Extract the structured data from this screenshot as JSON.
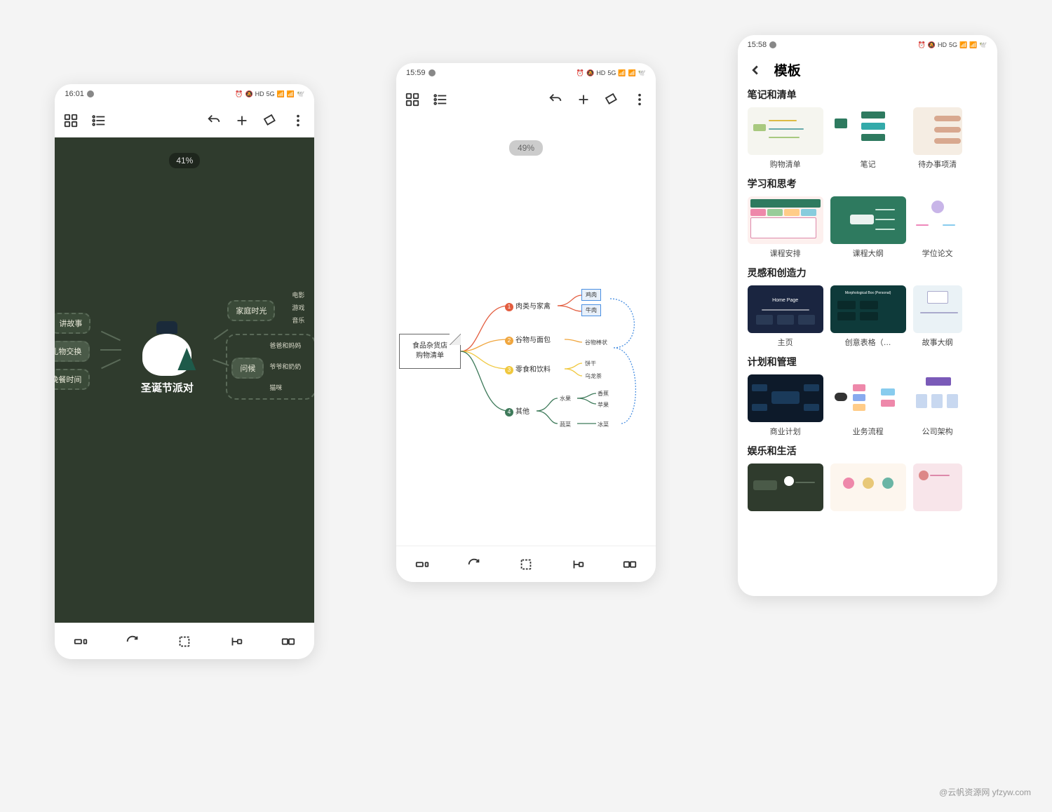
{
  "watermark": "@云帆资源网 yfzyw.com",
  "phone1": {
    "time": "16:01",
    "zoom": "41%",
    "mindmap": {
      "center": "圣诞节派对",
      "left_nodes": [
        "讲故事",
        "礼物交换",
        "晚餐时间"
      ],
      "right_top": {
        "label": "家庭时光",
        "leaves": [
          "电影",
          "游戏",
          "音乐"
        ]
      },
      "right_bottom": {
        "label": "问候",
        "leaves": [
          "爸爸和妈妈",
          "爷爷和奶奶",
          "猫咪"
        ]
      }
    }
  },
  "phone2": {
    "time": "15:59",
    "zoom": "49%",
    "mindmap": {
      "root_l1": "食品杂货店",
      "root_l2": "购物清单",
      "branches": [
        {
          "num": "1",
          "color": "#e35d3f",
          "label": "肉类与家禽",
          "subleaves": [
            "鸡肉",
            "牛肉"
          ]
        },
        {
          "num": "2",
          "color": "#f0a63e",
          "label": "谷物与面包",
          "subleaves": [
            "谷物棒状"
          ]
        },
        {
          "num": "3",
          "color": "#f0c83e",
          "label": "零食和饮料",
          "subleaves": [
            "饼干",
            "乌龙茶"
          ]
        },
        {
          "num": "4",
          "color": "#3e7a5a",
          "label": "其他",
          "children": [
            {
              "label": "水果",
              "subs": [
                "香蕉",
                "苹果"
              ]
            },
            {
              "label": "蔬菜",
              "subs": [
                "冰菜"
              ]
            }
          ]
        }
      ]
    }
  },
  "phone3": {
    "time": "15:58",
    "title": "模板",
    "sections": [
      {
        "title": "笔记和清单",
        "items": [
          {
            "caption": "购物清单",
            "bg": "#f5f5ef"
          },
          {
            "caption": "笔记",
            "bg": "#ffffff"
          },
          {
            "caption": "待办事项清",
            "bg": "#f5ede3"
          }
        ]
      },
      {
        "title": "学习和思考",
        "items": [
          {
            "caption": "课程安排",
            "bg": "#fdf0ee"
          },
          {
            "caption": "课程大纲",
            "bg": "#2e7a5f"
          },
          {
            "caption": "学位论文",
            "bg": "#ffffff"
          }
        ]
      },
      {
        "title": "灵感和创造力",
        "items": [
          {
            "caption": "主页",
            "bg": "#1a2540"
          },
          {
            "caption": "创意表格（…",
            "bg": "#0e3a3a"
          },
          {
            "caption": "故事大纲",
            "bg": "#eaf2f6"
          }
        ]
      },
      {
        "title": "计划和管理",
        "items": [
          {
            "caption": "商业计划",
            "bg": "#0d1a2a"
          },
          {
            "caption": "业务流程",
            "bg": "#ffffff"
          },
          {
            "caption": "公司架构",
            "bg": "#ffffff"
          }
        ]
      },
      {
        "title": "娱乐和生活",
        "items": [
          {
            "caption": "",
            "bg": "#2f3b2d"
          },
          {
            "caption": "",
            "bg": "#fdf6ee"
          },
          {
            "caption": "",
            "bg": "#f8e5ea"
          }
        ]
      }
    ]
  }
}
